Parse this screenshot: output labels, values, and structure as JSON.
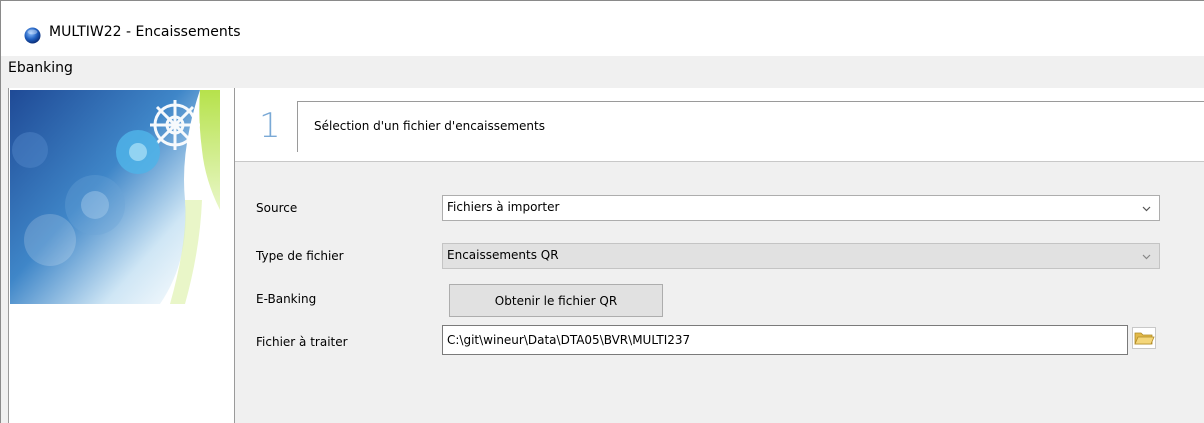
{
  "window": {
    "title": "MULTIW22 - Encaissements"
  },
  "menu": {
    "items": [
      "Ebanking"
    ]
  },
  "step": {
    "number": "1",
    "title": "Sélection d'un fichier d'encaissements"
  },
  "form": {
    "source": {
      "label": "Source",
      "value": "Fichiers à importer"
    },
    "file_type": {
      "label": "Type de fichier",
      "value": "Encaissements QR"
    },
    "ebanking": {
      "label": "E-Banking",
      "button_label": "Obtenir le fichier QR"
    },
    "file_to_process": {
      "label": "Fichier à traiter",
      "value": "C:\\git\\wineur\\Data\\DTA05\\BVR\\MULTI237"
    }
  },
  "icons": {
    "app": "app-globe-icon",
    "browse": "folder-open-icon",
    "dropdown": "chevron-down-icon"
  },
  "colors": {
    "step_number": "#7aa9d6",
    "panel_bg": "#f0f0f0"
  }
}
